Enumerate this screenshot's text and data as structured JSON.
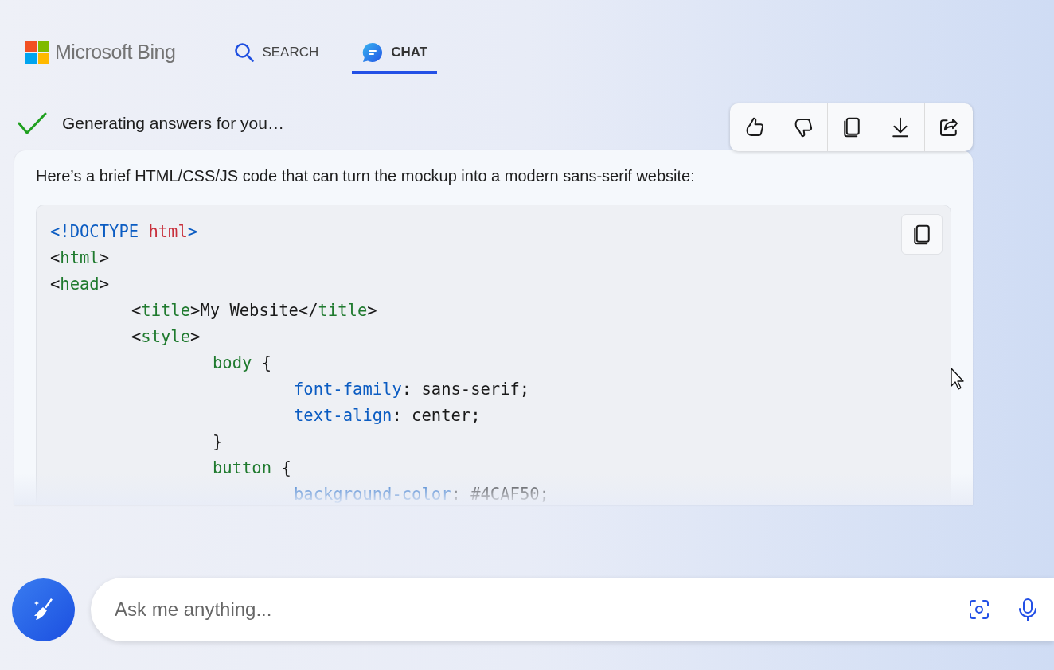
{
  "header": {
    "logo_text": "Microsoft Bing",
    "tabs": [
      {
        "label": "SEARCH",
        "kind": "search",
        "selected": false
      },
      {
        "label": "CHAT",
        "kind": "chat",
        "selected": true
      }
    ]
  },
  "status": {
    "text": "Generating answers for you…",
    "done": true
  },
  "actions": [
    {
      "kind": "like"
    },
    {
      "kind": "dislike"
    },
    {
      "kind": "copy"
    },
    {
      "kind": "download"
    },
    {
      "kind": "share"
    }
  ],
  "answer": {
    "intro": "Here’s a brief HTML/CSS/JS code that can turn the mockup into a modern sans-serif website:",
    "code": [
      {
        "tokens": [
          {
            "text": "<!DOCTYPE ",
            "kind": "keyword"
          },
          {
            "text": "html",
            "kind": "attr"
          },
          {
            "text": ">",
            "kind": "keyword"
          }
        ]
      },
      {
        "tokens": [
          {
            "text": "<",
            "kind": "plain"
          },
          {
            "text": "html",
            "kind": "tag"
          },
          {
            "text": ">",
            "kind": "plain"
          }
        ]
      },
      {
        "tokens": [
          {
            "text": "<",
            "kind": "plain"
          },
          {
            "text": "head",
            "kind": "tag"
          },
          {
            "text": ">",
            "kind": "plain"
          }
        ],
        "children": [
          {
            "tokens": [
              {
                "text": "<",
                "kind": "plain"
              },
              {
                "text": "title",
                "kind": "tag"
              },
              {
                "text": ">My Website</",
                "kind": "plain"
              },
              {
                "text": "title",
                "kind": "tag"
              },
              {
                "text": ">",
                "kind": "plain"
              }
            ]
          },
          {
            "tokens": [
              {
                "text": "<",
                "kind": "plain"
              },
              {
                "text": "style",
                "kind": "tag"
              },
              {
                "text": ">",
                "kind": "plain"
              }
            ],
            "children": [
              {
                "tokens": [
                  {
                    "text": "body",
                    "kind": "tag"
                  },
                  {
                    "text": " {",
                    "kind": "plain"
                  }
                ],
                "children": [
                  {
                    "tokens": [
                      {
                        "text": "font-family",
                        "kind": "keyword"
                      },
                      {
                        "text": ": sans-serif;",
                        "kind": "plain"
                      }
                    ]
                  },
                  {
                    "tokens": [
                      {
                        "text": "text-align",
                        "kind": "keyword"
                      },
                      {
                        "text": ": center;",
                        "kind": "plain"
                      }
                    ]
                  }
                ]
              },
              {
                "tokens": [
                  {
                    "text": "}",
                    "kind": "plain"
                  }
                ]
              },
              {
                "tokens": [
                  {
                    "text": "button",
                    "kind": "tag"
                  },
                  {
                    "text": " {",
                    "kind": "plain"
                  }
                ],
                "children": [
                  {
                    "tokens": [
                      {
                        "text": "background-color",
                        "kind": "keyword"
                      },
                      {
                        "text": ": #4CAF50;",
                        "kind": "plain"
                      }
                    ]
                  }
                ]
              }
            ]
          }
        ]
      }
    ]
  },
  "input": {
    "placeholder": "Ask me anything..."
  }
}
